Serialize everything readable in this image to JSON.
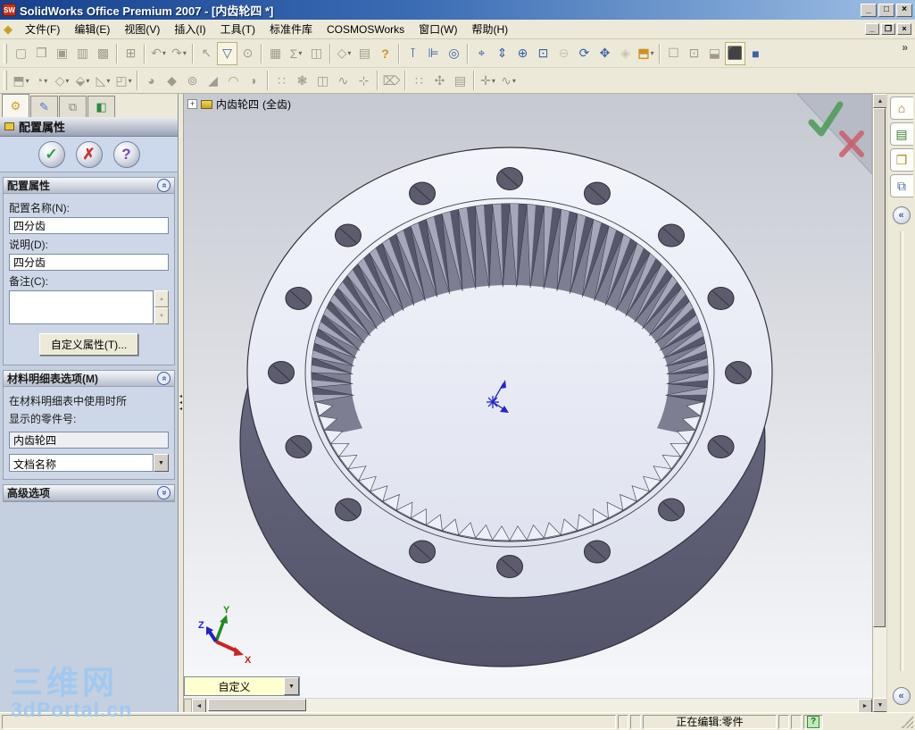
{
  "window": {
    "logo_text": "SW",
    "title": "SolidWorks Office Premium 2007 - [内齿轮四 *]",
    "controls": {
      "minimize": "_",
      "maximize": "□",
      "close": "×"
    },
    "doc_controls": {
      "minimize": "_",
      "restore": "❐",
      "close": "×"
    }
  },
  "menu": {
    "items": [
      "文件(F)",
      "编辑(E)",
      "视图(V)",
      "插入(I)",
      "工具(T)",
      "标准件库",
      "COSMOSWorks",
      "窗口(W)",
      "帮助(H)"
    ]
  },
  "toolbars": {
    "overflow": "»",
    "row1": [
      {
        "name": "new-document-button",
        "glyph": "▢",
        "style": "g"
      },
      {
        "name": "open-button",
        "glyph": "❒",
        "style": "g"
      },
      {
        "name": "save-button",
        "glyph": "▣",
        "style": "g"
      },
      {
        "name": "make-drawing-from-part-button",
        "glyph": "▥",
        "style": "g"
      },
      {
        "name": "make-assembly-from-part-button",
        "glyph": "▩",
        "style": "g"
      },
      {
        "sep": true
      },
      {
        "name": "print-button",
        "glyph": "⊞",
        "style": "g"
      },
      {
        "sep": true
      },
      {
        "name": "undo-button",
        "glyph": "↶",
        "style": "g",
        "dd": true
      },
      {
        "name": "redo-button",
        "glyph": "↷",
        "style": "g",
        "dd": true
      },
      {
        "sep": true
      },
      {
        "name": "select-button",
        "glyph": "↖",
        "style": "g"
      },
      {
        "name": "selection-filter-button",
        "glyph": "▽",
        "style": "p"
      },
      {
        "name": "select-other-button",
        "glyph": "⊙",
        "style": "g"
      },
      {
        "sep": true
      },
      {
        "name": "equations-button",
        "glyph": "▦",
        "style": "g"
      },
      {
        "name": "sketch-settings-button",
        "glyph": "Σ",
        "style": "g",
        "dd": true
      },
      {
        "name": "hide-show-items-button",
        "glyph": "◫",
        "style": "g"
      },
      {
        "sep": true
      },
      {
        "name": "view-orientation-button",
        "glyph": "◇",
        "style": "g",
        "dd": true
      },
      {
        "name": "options-button",
        "glyph": "▤",
        "style": "g"
      },
      {
        "name": "help-button",
        "glyph": "?",
        "style": "c"
      },
      {
        "sep": true
      },
      {
        "name": "measure-button",
        "glyph": "⊺",
        "style": "b"
      },
      {
        "name": "mass-properties-button",
        "glyph": "⊫",
        "style": "b"
      },
      {
        "name": "section-properties-button",
        "glyph": "◎",
        "style": "b"
      },
      {
        "sep": true
      },
      {
        "name": "zoom-to-fit-button",
        "glyph": "⌖",
        "style": "b"
      },
      {
        "name": "zoom-in-out-button",
        "glyph": "⇕",
        "style": "b"
      },
      {
        "name": "zoom-area-button",
        "glyph": "⊕",
        "style": "b"
      },
      {
        "name": "zoom-window-button",
        "glyph": "⊡",
        "style": "b"
      },
      {
        "name": "zoom-to-selection-button",
        "glyph": "⊖",
        "style": "d"
      },
      {
        "name": "rotate-view-button",
        "glyph": "⟳",
        "style": "b"
      },
      {
        "name": "pan-button",
        "glyph": "✥",
        "style": "b"
      },
      {
        "name": "3d-drawing-view-button",
        "glyph": "◈",
        "style": "d"
      },
      {
        "name": "standard-views-button",
        "glyph": "⬒",
        "style": "c",
        "dd": true
      },
      {
        "sep": true
      },
      {
        "name": "wireframe-button",
        "glyph": "☐",
        "style": "g"
      },
      {
        "name": "hidden-lines-visible-button",
        "glyph": "⊡",
        "style": "g"
      },
      {
        "name": "hidden-lines-removed-button",
        "glyph": "⬓",
        "style": "g"
      },
      {
        "name": "shaded-with-edges-button",
        "glyph": "⬛",
        "style": "p"
      },
      {
        "name": "shaded-button",
        "glyph": "■",
        "style": "b"
      }
    ],
    "row2": [
      {
        "name": "extruded-boss-button",
        "glyph": "⬒",
        "style": "g",
        "dd": true
      },
      {
        "name": "revolved-boss-button",
        "glyph": "◔",
        "style": "g",
        "dd": true
      },
      {
        "name": "swept-boss-button",
        "glyph": "◇",
        "style": "g",
        "dd": true
      },
      {
        "name": "lofted-boss-button",
        "glyph": "⬙",
        "style": "g",
        "dd": true
      },
      {
        "name": "rib-button",
        "glyph": "◺",
        "style": "g",
        "dd": true
      },
      {
        "name": "shell-button",
        "glyph": "◰",
        "style": "g",
        "dd": true
      },
      {
        "sep": true
      },
      {
        "name": "fillet-button",
        "glyph": "◕",
        "style": "g"
      },
      {
        "name": "chamfer-button",
        "glyph": "◆",
        "style": "g"
      },
      {
        "name": "hole-wizard-button",
        "glyph": "⊚",
        "style": "g"
      },
      {
        "name": "draft-button",
        "glyph": "◢",
        "style": "g"
      },
      {
        "name": "dome-button",
        "glyph": "◠",
        "style": "g"
      },
      {
        "name": "wrap-button",
        "glyph": "◗",
        "style": "g"
      },
      {
        "sep": true
      },
      {
        "name": "linear-pattern-button",
        "glyph": "∷",
        "style": "g"
      },
      {
        "name": "circular-pattern-button",
        "glyph": "❃",
        "style": "g"
      },
      {
        "name": "mirror-button",
        "glyph": "◫",
        "style": "g"
      },
      {
        "name": "curve-button",
        "glyph": "∿",
        "style": "g"
      },
      {
        "name": "reference-geometry-button",
        "glyph": "⊹",
        "style": "g"
      },
      {
        "sep": true
      },
      {
        "name": "delete-face-button",
        "glyph": "⌦",
        "style": "g"
      },
      {
        "sep": true
      },
      {
        "name": "hole-series-button",
        "glyph": "∷",
        "style": "g"
      },
      {
        "name": "smart-fasteners-button",
        "glyph": "✣",
        "style": "g"
      },
      {
        "name": "design-library-feature-button",
        "glyph": "▤",
        "style": "g"
      },
      {
        "sep": true
      },
      {
        "name": "sketch-entities-button",
        "glyph": "✛",
        "style": "g",
        "dd": true
      },
      {
        "name": "spline-button",
        "glyph": "∿",
        "style": "g",
        "dd": true
      }
    ]
  },
  "left_panel": {
    "tabs": [
      {
        "name": "featuremanager-tab",
        "glyph": "⚙",
        "color": "#c8a020"
      },
      {
        "name": "propertymanager-tab",
        "glyph": "✎",
        "color": "#4a76c8"
      },
      {
        "name": "configurationmanager-tab",
        "glyph": "⧉",
        "color": "#888888"
      },
      {
        "name": "cosmosworks-tab",
        "glyph": "◧",
        "color": "#2a8a3a"
      }
    ],
    "title": "配置属性",
    "actions": [
      {
        "name": "ok-button",
        "glyph": "✓",
        "cls": "glyph-ok"
      },
      {
        "name": "cancel-button",
        "glyph": "✗",
        "cls": "glyph-cancel"
      },
      {
        "name": "help-button",
        "glyph": "?",
        "cls": "glyph-help"
      }
    ],
    "collapse_glyph": "«",
    "groups": {
      "properties": {
        "title": "配置属性",
        "name_label": "配置名称(N):",
        "name_value": "四分齿",
        "desc_label": "说明(D):",
        "desc_value": "四分齿",
        "comment_label": "备注(C):",
        "comment_value": "",
        "custom_button": "自定义属性(T)..."
      },
      "bom": {
        "title": "材料明细表选项(M)",
        "description_line1": "在材料明细表中使用时所",
        "description_line2": "显示的零件号:",
        "part_number": "内齿轮四",
        "doc_name_option": "文档名称"
      },
      "advanced": {
        "title": "高级选项"
      }
    },
    "splitter_arrow": "◂"
  },
  "viewport": {
    "tree_node": {
      "expand": "+",
      "label": "内齿轮四",
      "suffix": "(全齿)"
    },
    "config_combo": {
      "value": "自定义",
      "arrow": "▼"
    },
    "triad": {
      "x_label": "X",
      "y_label": "Y",
      "z_label": "Z"
    },
    "model": {
      "name": "internal-ring-gear",
      "teeth_count": 72,
      "bolt_hole_count": 16,
      "colors": {
        "background_top": "#c6c9d1",
        "background_bottom": "#f5f6f9",
        "flange_light": "#f3f5fb",
        "flange_dark": "#dde1ed",
        "wall_dark": "#53536a",
        "wall_light": "#72728a",
        "outline": "#32323f",
        "hole": "#5c5c6e",
        "tooth_light": "#a7a7bb",
        "tooth_dark": "#57576b",
        "tooth_band": "#7e7e93",
        "tooth_bottom": "#edeff6",
        "origin_blue": "#2323cf",
        "axis_x": "#cc2222",
        "axis_y": "#1f8c1f",
        "axis_z": "#2222cc",
        "accept_green": "#4a9a55",
        "cancel_red": "#c9606c"
      }
    }
  },
  "task_pane": {
    "tabs": [
      {
        "name": "solidworks-resources-tab",
        "glyph": "⌂",
        "color": "#b06820"
      },
      {
        "name": "design-library-tab",
        "glyph": "▤",
        "color": "#3a7a3a"
      },
      {
        "name": "file-explorer-tab",
        "glyph": "❒",
        "color": "#b08820"
      },
      {
        "name": "view-palette-tab",
        "glyph": "⧉",
        "color": "#4a6aaa"
      }
    ],
    "collapse_glyph": "«"
  },
  "scrollbars": {
    "left": "◄",
    "right": "►",
    "up": "▲",
    "down": "▼"
  },
  "status_bar": {
    "editing_text": "正在编辑:零件",
    "help_glyph": "?"
  },
  "watermark": {
    "line1": "三维网",
    "line2": "3dPortal.cn"
  }
}
